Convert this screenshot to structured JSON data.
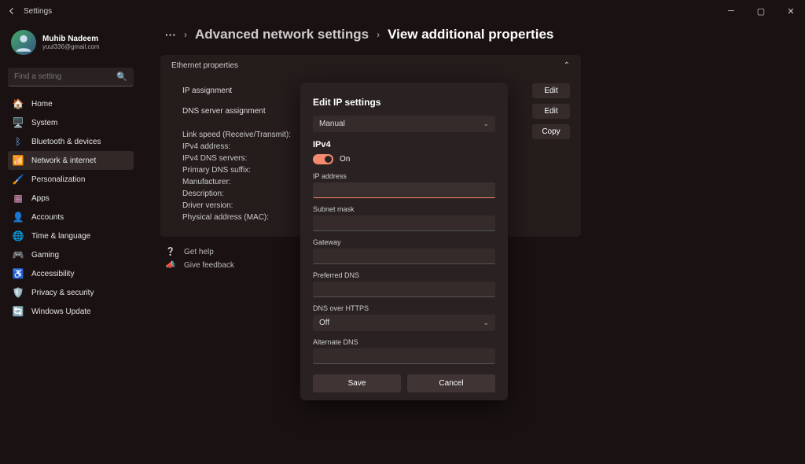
{
  "title": "Settings",
  "user": {
    "name": "Muhib Nadeem",
    "email": "yuul336@gmail.com"
  },
  "search": {
    "placeholder": "Find a setting"
  },
  "sidebar": {
    "items": [
      {
        "label": "Home",
        "icon": "home-icon",
        "color": "ic-blue"
      },
      {
        "label": "System",
        "icon": "system-icon",
        "color": "ic-blue"
      },
      {
        "label": "Bluetooth & devices",
        "icon": "bluetooth-icon",
        "color": "ic-blue"
      },
      {
        "label": "Network & internet",
        "icon": "wifi-icon",
        "color": "ic-teal",
        "active": true
      },
      {
        "label": "Personalization",
        "icon": "brush-icon",
        "color": "ic-yel"
      },
      {
        "label": "Apps",
        "icon": "apps-icon",
        "color": "ic-pink"
      },
      {
        "label": "Accounts",
        "icon": "person-icon",
        "color": "ic-green"
      },
      {
        "label": "Time & language",
        "icon": "globe-icon",
        "color": "ic-cyan"
      },
      {
        "label": "Gaming",
        "icon": "gamepad-icon",
        "color": "ic-gray"
      },
      {
        "label": "Accessibility",
        "icon": "accessibility-icon",
        "color": "ic-pur"
      },
      {
        "label": "Privacy & security",
        "icon": "shield-icon",
        "color": "ic-gray"
      },
      {
        "label": "Windows Update",
        "icon": "update-icon",
        "color": "ic-blue"
      }
    ]
  },
  "breadcrumb": {
    "dots": "···",
    "level1": "Advanced network settings",
    "level2": "View additional properties"
  },
  "panel": {
    "header": "Ethernet properties",
    "rows": [
      {
        "label": "IP assignment",
        "action": "Edit"
      },
      {
        "label": "DNS server assignment",
        "action": "Edit"
      }
    ],
    "prop_labels": [
      "Link speed (Receive/Transmit):",
      "IPv4 address:",
      "IPv4 DNS servers:",
      "Primary DNS suffix:",
      "Manufacturer:",
      "Description:",
      "Driver version:",
      "Physical address (MAC):"
    ],
    "copy_label": "Copy"
  },
  "help": {
    "get_help": "Get help",
    "feedback": "Give feedback"
  },
  "dialog": {
    "title": "Edit IP settings",
    "mode": "Manual",
    "ipv4_heading": "IPv4",
    "toggle_label": "On",
    "fields": {
      "ip_address": "IP address",
      "subnet_mask": "Subnet mask",
      "gateway": "Gateway",
      "preferred_dns": "Preferred DNS",
      "dns_over_https": "DNS over HTTPS",
      "dns_over_https_value": "Off",
      "alternate_dns": "Alternate DNS"
    },
    "buttons": {
      "save": "Save",
      "cancel": "Cancel"
    }
  }
}
